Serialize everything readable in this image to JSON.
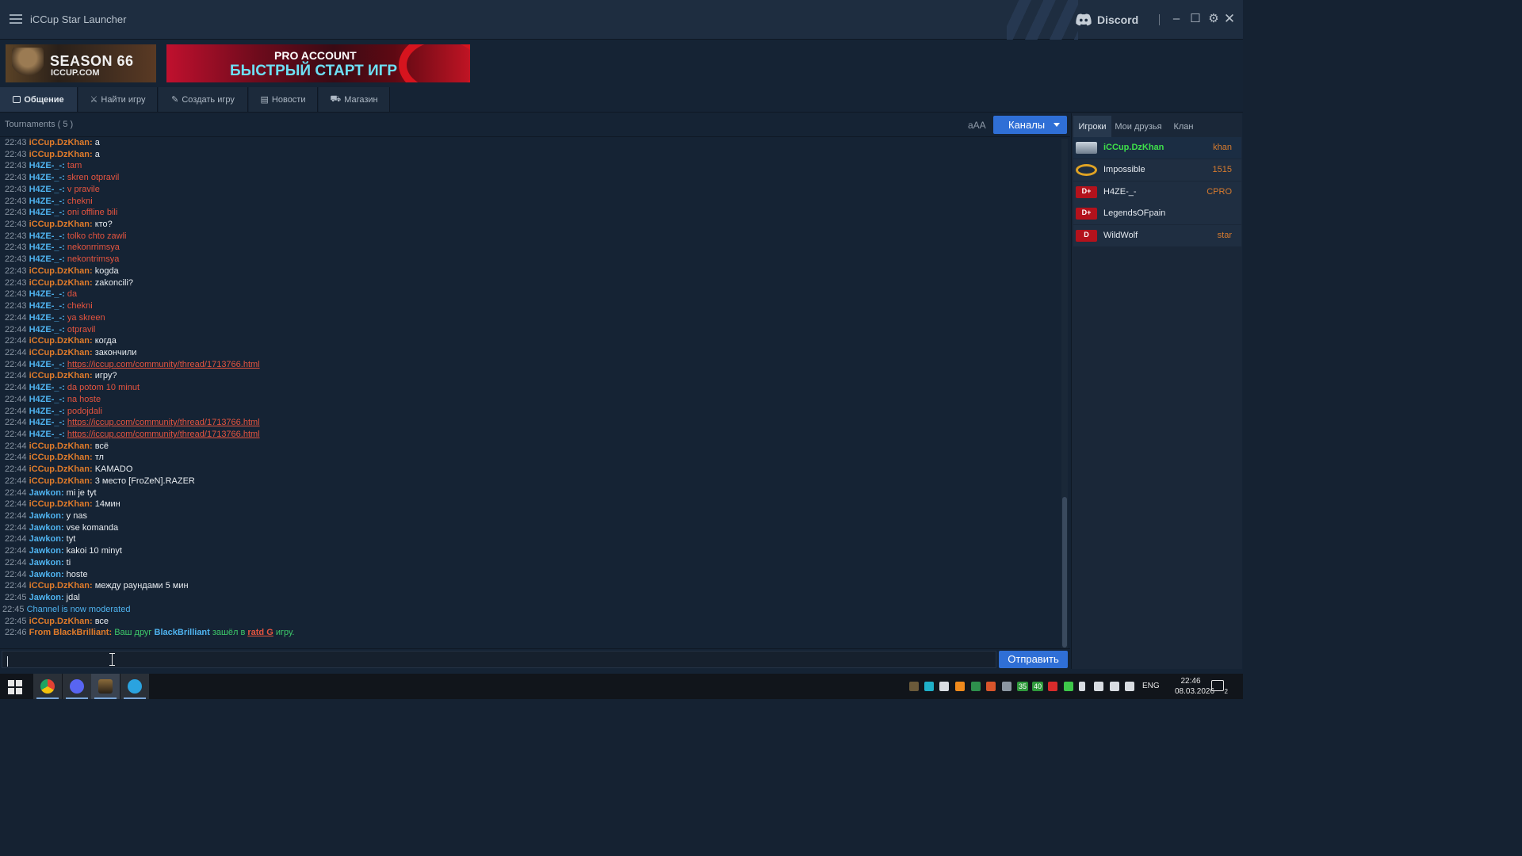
{
  "window": {
    "title": "iCCup Star Launcher",
    "discord_label": "Discord"
  },
  "banners": {
    "season": {
      "line1": "SEASON 66",
      "line2": "ICCUP.COM"
    },
    "pro": {
      "line1": "PRO ACCOUNT",
      "line2": "БЫСТРЫЙ СТАРТ ИГР"
    }
  },
  "tabs": [
    {
      "label": "Общение",
      "active": true
    },
    {
      "label": "Найти игру",
      "active": false
    },
    {
      "label": "Создать игру",
      "active": false
    },
    {
      "label": "Новости",
      "active": false
    },
    {
      "label": "Магазин",
      "active": false
    }
  ],
  "chat": {
    "channel": "Tournaments",
    "count": "( 5 )",
    "font_size_label": "aAA",
    "channels_button": "Каналы",
    "send_button": "Отправить",
    "input_value": "",
    "messages": [
      {
        "time": "22:43",
        "nick": "iCCup.DzKhan:",
        "text": "a",
        "kind": "khan"
      },
      {
        "time": "22:43",
        "nick": "iCCup.DzKhan:",
        "text": "a",
        "kind": "khan"
      },
      {
        "time": "22:43",
        "nick": "H4ZE-_-:",
        "text": "tam",
        "kind": "haze"
      },
      {
        "time": "22:43",
        "nick": "H4ZE-_-:",
        "text": "skren otpravil",
        "kind": "haze"
      },
      {
        "time": "22:43",
        "nick": "H4ZE-_-:",
        "text": "v pravile",
        "kind": "haze"
      },
      {
        "time": "22:43",
        "nick": "H4ZE-_-:",
        "text": "chekni",
        "kind": "haze"
      },
      {
        "time": "22:43",
        "nick": "H4ZE-_-:",
        "text": "oni offline bili",
        "kind": "haze"
      },
      {
        "time": "22:43",
        "nick": "iCCup.DzKhan:",
        "text": "кто?",
        "kind": "khan"
      },
      {
        "time": "22:43",
        "nick": "H4ZE-_-:",
        "text": "tolko chto zawli",
        "kind": "haze"
      },
      {
        "time": "22:43",
        "nick": "H4ZE-_-:",
        "text": "nekonrrimsya",
        "kind": "haze"
      },
      {
        "time": "22:43",
        "nick": "H4ZE-_-:",
        "text": "nekontrimsya",
        "kind": "haze"
      },
      {
        "time": "22:43",
        "nick": "iCCup.DzKhan:",
        "text": "kogda",
        "kind": "khan"
      },
      {
        "time": "22:43",
        "nick": "iCCup.DzKhan:",
        "text": "zakoncili?",
        "kind": "khan"
      },
      {
        "time": "22:43",
        "nick": "H4ZE-_-:",
        "text": "da",
        "kind": "haze"
      },
      {
        "time": "22:43",
        "nick": "H4ZE-_-:",
        "text": "chekni",
        "kind": "haze"
      },
      {
        "time": "22:44",
        "nick": "H4ZE-_-:",
        "text": "ya skreen",
        "kind": "haze"
      },
      {
        "time": "22:44",
        "nick": "H4ZE-_-:",
        "text": "otpravil",
        "kind": "haze"
      },
      {
        "time": "22:44",
        "nick": "iCCup.DzKhan:",
        "text": "когда",
        "kind": "khan"
      },
      {
        "time": "22:44",
        "nick": "iCCup.DzKhan:",
        "text": "закончили",
        "kind": "khan"
      },
      {
        "time": "22:44",
        "nick": "H4ZE-_-:",
        "text": "https://iccup.com/community/thread/1713766.html",
        "kind": "haze-link"
      },
      {
        "time": "22:44",
        "nick": "iCCup.DzKhan:",
        "text": "игру?",
        "kind": "khan"
      },
      {
        "time": "22:44",
        "nick": "H4ZE-_-:",
        "text": "da potom 10 minut",
        "kind": "haze"
      },
      {
        "time": "22:44",
        "nick": "H4ZE-_-:",
        "text": "na hoste",
        "kind": "haze"
      },
      {
        "time": "22:44",
        "nick": "H4ZE-_-:",
        "text": "podojdali",
        "kind": "haze"
      },
      {
        "time": "22:44",
        "nick": "H4ZE-_-:",
        "text": "https://iccup.com/community/thread/1713766.html",
        "kind": "haze-link"
      },
      {
        "time": "22:44",
        "nick": "H4ZE-_-:",
        "text": "https://iccup.com/community/thread/1713766.html",
        "kind": "haze-link"
      },
      {
        "time": "22:44",
        "nick": "iCCup.DzKhan:",
        "text": "всё",
        "kind": "khan"
      },
      {
        "time": "22:44",
        "nick": "iCCup.DzKhan:",
        "text": "тл",
        "kind": "khan"
      },
      {
        "time": "22:44",
        "nick": "iCCup.DzKhan:",
        "text": "KAMADO",
        "kind": "khan"
      },
      {
        "time": "22:44",
        "nick": "iCCup.DzKhan:",
        "text": "3 место [FroZeN].RAZER",
        "kind": "khan"
      },
      {
        "time": "22:44",
        "nick": "Jawkon:",
        "text": "mi je tyt",
        "kind": "jawkon"
      },
      {
        "time": "22:44",
        "nick": "iCCup.DzKhan:",
        "text": "14мин",
        "kind": "khan"
      },
      {
        "time": "22:44",
        "nick": "Jawkon:",
        "text": "y nas",
        "kind": "jawkon"
      },
      {
        "time": "22:44",
        "nick": "Jawkon:",
        "text": "vse komanda",
        "kind": "jawkon"
      },
      {
        "time": "22:44",
        "nick": "Jawkon:",
        "text": "tyt",
        "kind": "jawkon"
      },
      {
        "time": "22:44",
        "nick": "Jawkon:",
        "text": "kakoi 10 minyt",
        "kind": "jawkon"
      },
      {
        "time": "22:44",
        "nick": "Jawkon:",
        "text": "ti",
        "kind": "jawkon"
      },
      {
        "time": "22:44",
        "nick": "Jawkon:",
        "text": "hoste",
        "kind": "jawkon"
      },
      {
        "time": "22:44",
        "nick": "iCCup.DzKhan:",
        "text": "между раундами 5 мин",
        "kind": "khan"
      },
      {
        "time": "22:45",
        "nick": "Jawkon:",
        "text": "jdal",
        "kind": "jawkon"
      },
      {
        "time": "22:45",
        "nick": "",
        "text": "Channel is now moderated",
        "kind": "system"
      },
      {
        "time": "22:45",
        "nick": "iCCup.DzKhan:",
        "text": "все",
        "kind": "khan"
      },
      {
        "time": "22:46",
        "nick": "From BlackBrilliant:",
        "text": "",
        "kind": "whisper",
        "parts": {
          "pre": "Ваш друг ",
          "friend": "BlackBrilliant",
          "mid": " зашёл в ",
          "game": "ratd G",
          "post": " игру."
        }
      }
    ]
  },
  "sidebar": {
    "tabs": [
      {
        "label": "Игроки",
        "active": true
      },
      {
        "label": "Мои друзья",
        "active": false
      },
      {
        "label": "Клан",
        "active": false
      }
    ],
    "players": [
      {
        "name": "iCCup.DzKhan",
        "rating": "khan",
        "name_color": "#3ee04a",
        "badge": "wings"
      },
      {
        "name": "Impossible",
        "rating": "1515",
        "name_color": "#e4e9ef",
        "badge": "infinity"
      },
      {
        "name": "H4ZE-_-",
        "rating": "CPRO",
        "name_color": "#e4e9ef",
        "badge": "dplus"
      },
      {
        "name": "LegendsOFpain",
        "rating": "",
        "name_color": "#e4e9ef",
        "badge": "dplus"
      },
      {
        "name": "WildWolf",
        "rating": "star",
        "name_color": "#e4e9ef",
        "badge": "d"
      }
    ]
  },
  "taskbar": {
    "apps": [
      "chrome-icon",
      "discord-icon",
      "iccup-icon",
      "telegram-icon"
    ],
    "tray_badges": [
      "35",
      "40"
    ],
    "lang": "ENG",
    "time": "22:46",
    "date": "08.03.2026",
    "notifications": "2"
  },
  "colors": {
    "khan": "#e07b2a",
    "haze_nick": "#4fb3ef",
    "haze_text": "#e5543f",
    "jawkon": "#4fb3ef",
    "system": "#4fb3ef",
    "whisper_nick": "#e07b2a",
    "whisper_text": "#3dc96a",
    "accent": "#2f6fd6"
  }
}
